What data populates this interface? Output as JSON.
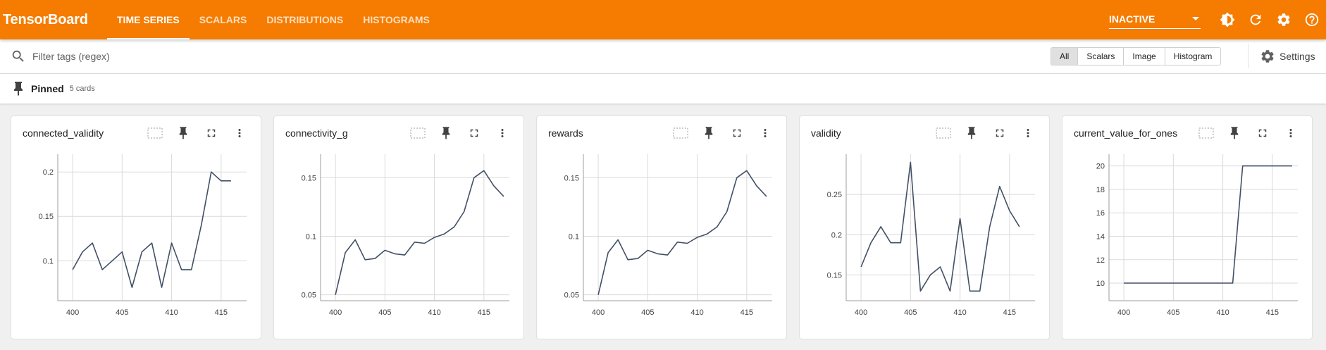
{
  "app": {
    "title": "TensorBoard",
    "tabs": [
      "TIME SERIES",
      "SCALARS",
      "DISTRIBUTIONS",
      "HISTOGRAMS"
    ],
    "active_tab": "TIME SERIES",
    "status": "INACTIVE"
  },
  "filter": {
    "placeholder": "Filter tags (regex)",
    "types": [
      "All",
      "Scalars",
      "Image",
      "Histogram"
    ],
    "active_type": "All",
    "settings_label": "Settings"
  },
  "pinned": {
    "label": "Pinned",
    "count": "5 cards"
  },
  "colors": {
    "header": "#f57c00",
    "line": "#425066"
  },
  "chart_data": [
    {
      "type": "line",
      "title": "connected_validity",
      "x": [
        400,
        401,
        402,
        403,
        404,
        405,
        406,
        407,
        408,
        409,
        410,
        411,
        412,
        413,
        414,
        415,
        416
      ],
      "y": [
        0.09,
        0.11,
        0.12,
        0.09,
        0.1,
        0.11,
        0.07,
        0.11,
        0.12,
        0.07,
        0.12,
        0.09,
        0.09,
        0.14,
        0.2,
        0.19,
        0.19
      ],
      "xlim": [
        398.5,
        418
      ],
      "ylim": [
        0.055,
        0.22
      ],
      "xticks": [
        400,
        405,
        410,
        415
      ],
      "yticks": [
        0.1,
        0.15,
        0.2
      ],
      "yticklabels": [
        "0.1",
        "0.15",
        "0.2"
      ],
      "grid": true
    },
    {
      "type": "line",
      "title": "connectivity_g",
      "x": [
        400,
        401,
        402,
        403,
        404,
        405,
        406,
        407,
        408,
        409,
        410,
        411,
        412,
        413,
        414,
        415,
        416,
        417
      ],
      "y": [
        0.05,
        0.086,
        0.097,
        0.08,
        0.081,
        0.088,
        0.085,
        0.084,
        0.095,
        0.094,
        0.099,
        0.102,
        0.108,
        0.121,
        0.15,
        0.156,
        0.143,
        0.134
      ],
      "xlim": [
        398.5,
        418
      ],
      "ylim": [
        0.045,
        0.17
      ],
      "xticks": [
        400,
        405,
        410,
        415
      ],
      "yticks": [
        0.05,
        0.1,
        0.15
      ],
      "yticklabels": [
        "0.05",
        "0.1",
        "0.15"
      ],
      "grid": true
    },
    {
      "type": "line",
      "title": "rewards",
      "x": [
        400,
        401,
        402,
        403,
        404,
        405,
        406,
        407,
        408,
        409,
        410,
        411,
        412,
        413,
        414,
        415,
        416,
        417
      ],
      "y": [
        0.05,
        0.086,
        0.097,
        0.08,
        0.081,
        0.088,
        0.085,
        0.084,
        0.095,
        0.094,
        0.099,
        0.102,
        0.108,
        0.121,
        0.15,
        0.156,
        0.143,
        0.134
      ],
      "xlim": [
        398.5,
        418
      ],
      "ylim": [
        0.045,
        0.17
      ],
      "xticks": [
        400,
        405,
        410,
        415
      ],
      "yticks": [
        0.05,
        0.1,
        0.15
      ],
      "yticklabels": [
        "0.05",
        "0.1",
        "0.15"
      ],
      "grid": true
    },
    {
      "type": "line",
      "title": "validity",
      "x": [
        400,
        401,
        402,
        403,
        404,
        405,
        406,
        407,
        408,
        409,
        410,
        411,
        412,
        413,
        414,
        415,
        416
      ],
      "y": [
        0.16,
        0.19,
        0.21,
        0.19,
        0.19,
        0.29,
        0.13,
        0.15,
        0.16,
        0.13,
        0.22,
        0.13,
        0.13,
        0.21,
        0.26,
        0.23,
        0.21
      ],
      "xlim": [
        398.5,
        418
      ],
      "ylim": [
        0.118,
        0.3
      ],
      "xticks": [
        400,
        405,
        410,
        415
      ],
      "yticks": [
        0.15,
        0.2,
        0.25
      ],
      "yticklabels": [
        "0.15",
        "0.2",
        "0.25"
      ],
      "grid": true
    },
    {
      "type": "line",
      "title": "current_value_for_ones",
      "x": [
        400,
        401,
        402,
        403,
        404,
        405,
        406,
        407,
        408,
        409,
        410,
        411,
        412,
        413,
        414,
        415,
        416,
        417
      ],
      "y": [
        10,
        10,
        10,
        10,
        10,
        10,
        10,
        10,
        10,
        10,
        10,
        10,
        20,
        20,
        20,
        20,
        20,
        20
      ],
      "xlim": [
        398.5,
        418
      ],
      "ylim": [
        8.5,
        21
      ],
      "xticks": [
        400,
        405,
        410,
        415
      ],
      "yticks": [
        10,
        12,
        14,
        16,
        18,
        20
      ],
      "yticklabels": [
        "10",
        "12",
        "14",
        "16",
        "18",
        "20"
      ],
      "grid": true
    }
  ]
}
